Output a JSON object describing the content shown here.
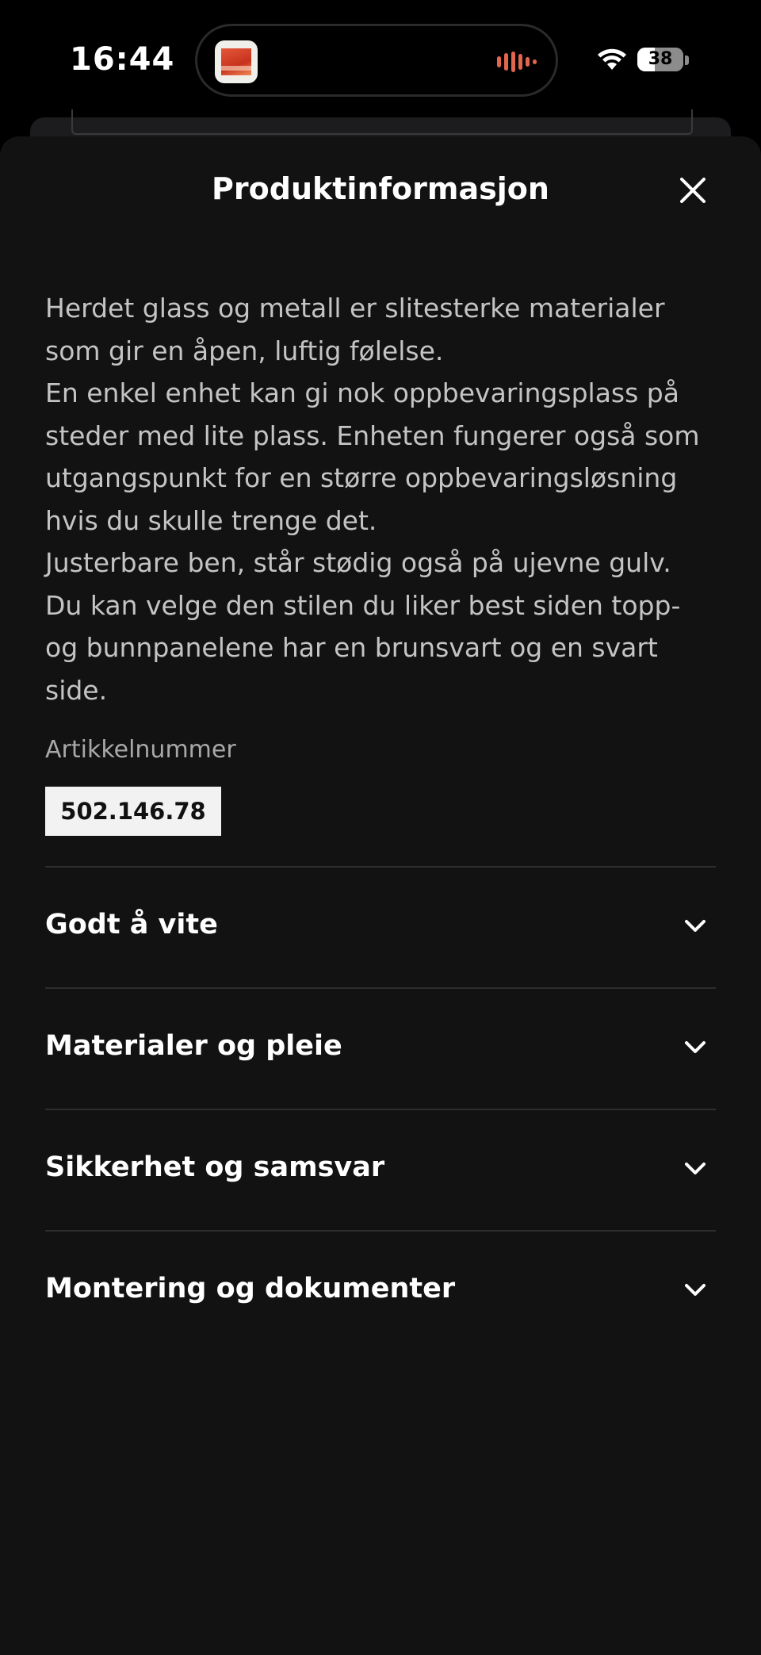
{
  "status_bar": {
    "time": "16:44",
    "battery_percent": "38",
    "battery_level": 0.38,
    "wifi_icon": "wifi-icon",
    "island_app_icon": "app-icon",
    "island_wave_icon": "waveform-icon",
    "island_accent_color": "#e0664e"
  },
  "sheet": {
    "title": "Produktinformasjon",
    "close_icon": "close-icon",
    "description": [
      "Herdet glass og metall er slitesterke materialer som gir en åpen, luftig følelse.",
      "En enkel enhet kan gi nok oppbevaringsplass på steder med lite plass. Enheten fungerer også som utgangspunkt for en større oppbevaringsløsning hvis du skulle trenge det.",
      "Justerbare ben, står stødig også på ujevne gulv.",
      "Du kan velge den stilen du liker best siden topp- og bunnpanelene har en brunsvart og en svart side."
    ],
    "article_label": "Artikkelnummer",
    "article_number": "502.146.78",
    "accordion": [
      {
        "label": "Godt å vite",
        "icon": "chevron-down-icon"
      },
      {
        "label": "Materialer og pleie",
        "icon": "chevron-down-icon"
      },
      {
        "label": "Sikkerhet og samsvar",
        "icon": "chevron-down-icon"
      },
      {
        "label": "Montering og dokumenter",
        "icon": "chevron-down-icon"
      }
    ]
  },
  "colors": {
    "background": "#000000",
    "sheet_background": "#121212",
    "text_primary": "#ffffff",
    "text_secondary": "#c4c4c4",
    "article_badge_bg": "#f2f2f2",
    "divider": "#2e2e2e"
  }
}
